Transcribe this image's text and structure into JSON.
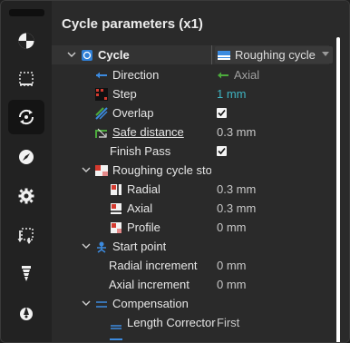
{
  "panel": {
    "title": "Cycle parameters (x1)"
  },
  "sidebar": {
    "icons": [
      "pie-chart-icon",
      "dashed-box-icon",
      "cycle-icon",
      "compass-icon",
      "gear-icon",
      "dashed-arrows-icon",
      "drill-icon",
      "stylus-icon"
    ],
    "active": "cycle-icon",
    "help_mark": "?"
  },
  "tree": {
    "cycle": {
      "label": "Cycle",
      "value": "Roughing cycle"
    },
    "direction": {
      "label": "Direction",
      "value": "Axial"
    },
    "step": {
      "label": "Step",
      "value": "1 mm"
    },
    "overlap": {
      "label": "Overlap",
      "checked": true
    },
    "safe_distance": {
      "label": "Safe distance",
      "value": "0.3 mm"
    },
    "finish_pass": {
      "label": "Finish Pass",
      "checked": true
    },
    "roughing_stock": {
      "label": "Roughing cycle stoc"
    },
    "radial": {
      "label": "Radial",
      "value": "0.3 mm"
    },
    "axial": {
      "label": "Axial",
      "value": "0.3 mm"
    },
    "profile": {
      "label": "Profile",
      "value": "0 mm"
    },
    "start_point": {
      "label": "Start point"
    },
    "radial_increment": {
      "label": "Radial increment",
      "value": "0 mm"
    },
    "axial_increment": {
      "label": "Axial increment",
      "value": "0 mm"
    },
    "compensation": {
      "label": "Compensation"
    },
    "length_corrector": {
      "label": "Length Corrector",
      "value": "First"
    }
  },
  "colors": {
    "accent": "#3fb4c2",
    "background": "#2a2a2a",
    "toolbar": "#222222"
  }
}
